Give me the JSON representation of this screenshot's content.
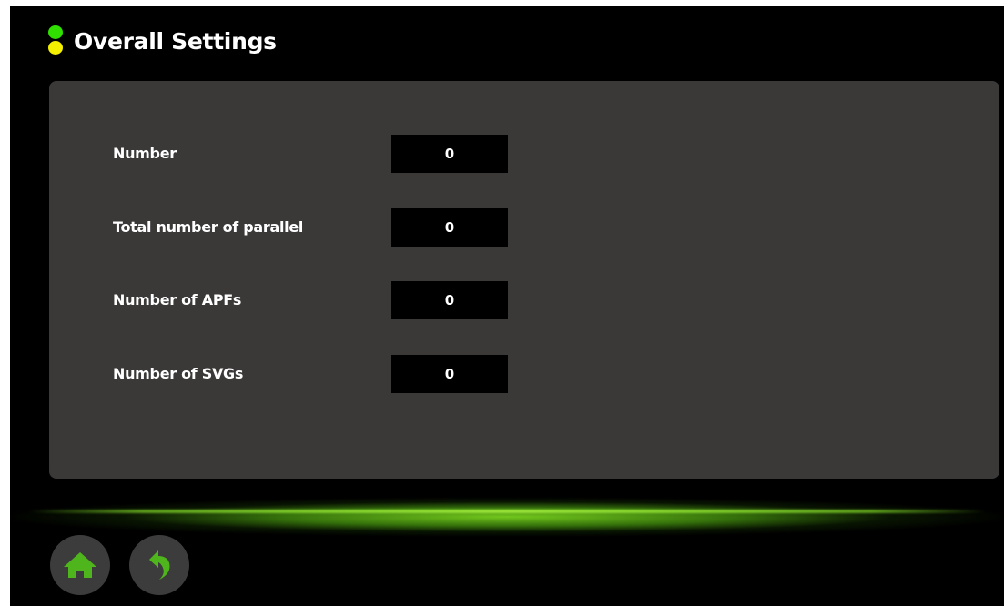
{
  "title": "Overall Settings",
  "status_indicators": [
    {
      "name": "green-indicator",
      "color": "#2fe000"
    },
    {
      "name": "yellow-indicator",
      "color": "#f4f000"
    }
  ],
  "settings": [
    {
      "label": "Number",
      "value": "0"
    },
    {
      "label": "Total number of parallel",
      "value": "0"
    },
    {
      "label": "Number of APFs",
      "value": "0"
    },
    {
      "label": "Number of SVGs",
      "value": "0"
    }
  ],
  "nav": {
    "home_icon": "home-icon",
    "back_icon": "back-arrow-icon",
    "icon_color": "#4fb51c"
  }
}
